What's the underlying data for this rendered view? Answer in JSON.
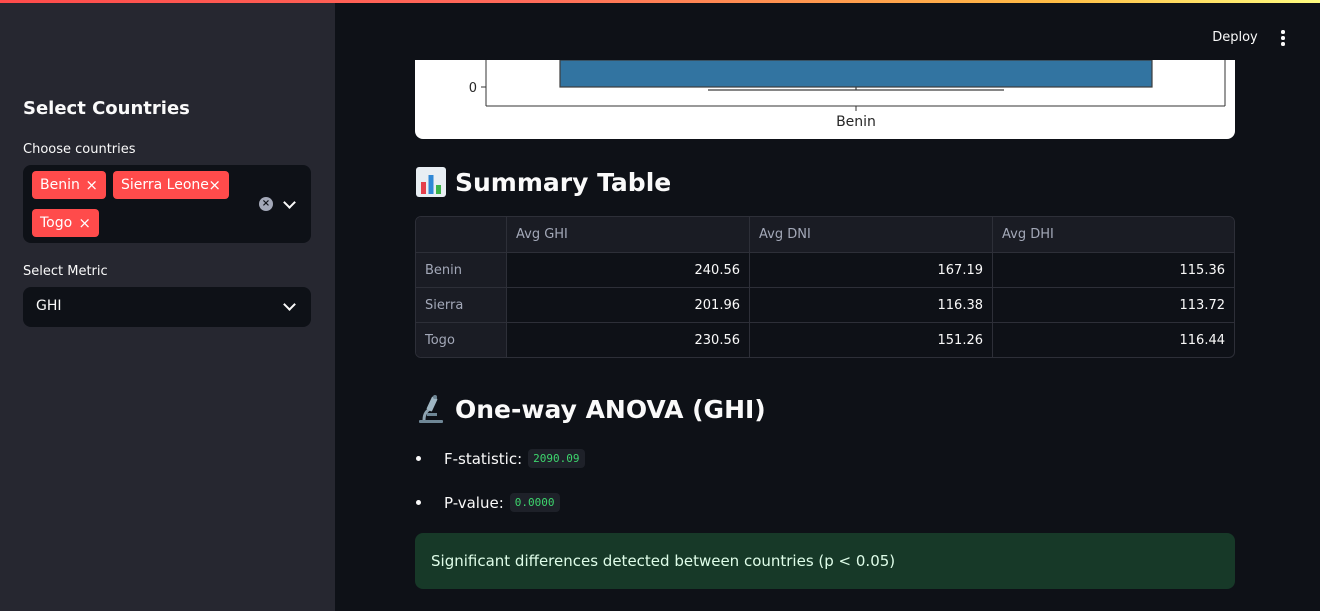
{
  "header": {
    "deploy_label": "Deploy",
    "menu_icon": "kebab-menu-icon"
  },
  "sidebar": {
    "title": "Select Countries",
    "countries_label": "Choose countries",
    "selected_countries": [
      "Benin",
      "Sierra Leone",
      "Togo"
    ],
    "chip_remove_glyph": "×",
    "clear_glyph": "×",
    "metric_label": "Select Metric",
    "metric_value": "GHI"
  },
  "chart": {
    "type": "boxplot",
    "y_tick": "0",
    "x_tick": "Benin",
    "box_color": "#3274a1"
  },
  "summary": {
    "title": "Summary Table",
    "icon": "bar-chart-emoji-icon",
    "columns": [
      "",
      "Avg GHI",
      "Avg DNI",
      "Avg DHI"
    ],
    "rows": [
      {
        "country": "Benin",
        "ghi": "240.56",
        "dni": "167.19",
        "dhi": "115.36"
      },
      {
        "country": "Sierra Leone",
        "ghi": "201.96",
        "dni": "116.38",
        "dhi": "113.72"
      },
      {
        "country": "Togo",
        "ghi": "230.56",
        "dni": "151.26",
        "dhi": "116.44"
      }
    ]
  },
  "anova": {
    "title": "One-way ANOVA (GHI)",
    "icon": "microscope-emoji-icon",
    "f_label": "F-statistic:",
    "f_value": "2090.09",
    "p_label": "P-value:",
    "p_value": "0.0000"
  },
  "alert": {
    "text": "Significant differences detected between countries (p < 0.05)",
    "color": "#173928"
  }
}
